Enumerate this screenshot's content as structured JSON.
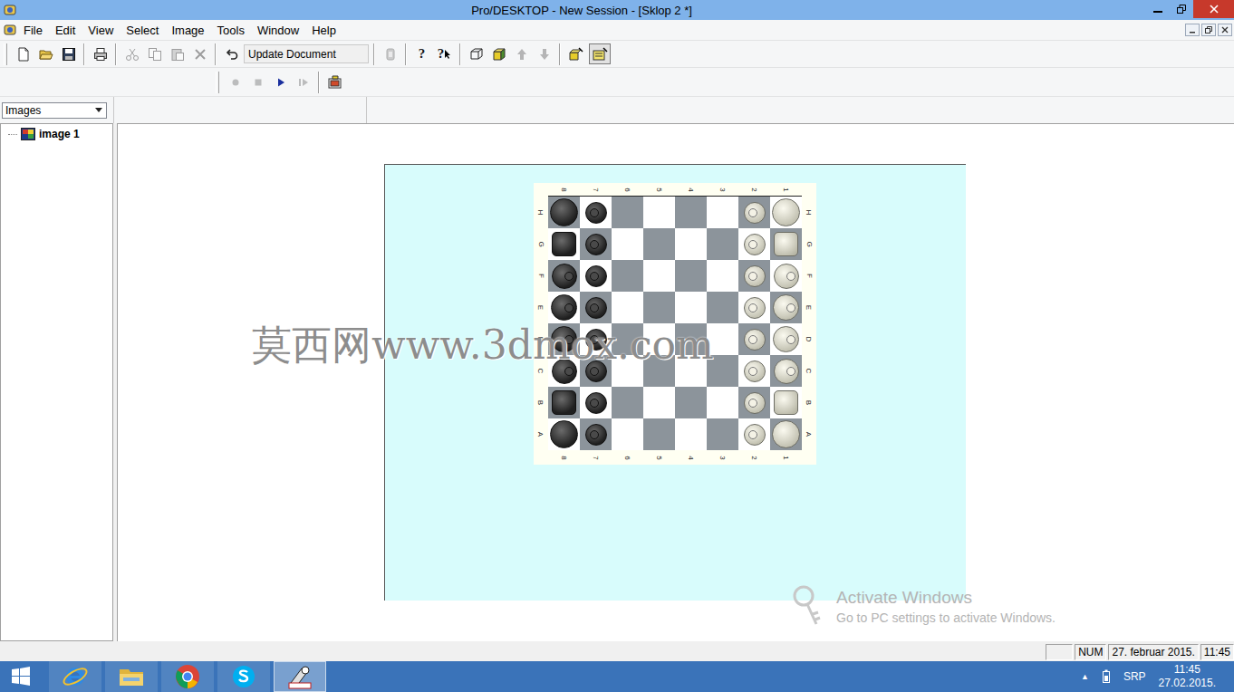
{
  "window": {
    "title": "Pro/DESKTOP - New Session - [Sklop 2 *]"
  },
  "menu": [
    "File",
    "Edit",
    "View",
    "Select",
    "Image",
    "Tools",
    "Window",
    "Help"
  ],
  "toolbar": [
    {
      "kind": "grip"
    },
    {
      "kind": "button",
      "disabled": false,
      "pressed": false
    },
    {
      "kind": "button",
      "disabled": false,
      "pressed": false
    },
    {
      "kind": "button",
      "disabled": false,
      "pressed": false
    },
    {
      "kind": "separator"
    },
    {
      "kind": "button",
      "disabled": false,
      "pressed": false
    },
    {
      "kind": "separator"
    },
    {
      "kind": "button",
      "disabled": true,
      "pressed": false
    },
    {
      "kind": "button",
      "disabled": true,
      "pressed": false
    },
    {
      "kind": "button",
      "disabled": true,
      "pressed": false
    },
    {
      "kind": "button",
      "disabled": true,
      "pressed": false
    },
    {
      "kind": "separator"
    },
    {
      "kind": "button",
      "disabled": false,
      "pressed": false
    },
    {
      "kind": "field",
      "text": "Update Document"
    },
    {
      "kind": "separator"
    },
    {
      "kind": "button",
      "disabled": true,
      "pressed": false
    },
    {
      "kind": "separator"
    },
    {
      "kind": "button",
      "disabled": false,
      "pressed": false,
      "glyph": "?"
    },
    {
      "kind": "button",
      "disabled": false,
      "pressed": false,
      "glyph": "?"
    },
    {
      "kind": "separator"
    },
    {
      "kind": "button",
      "disabled": false,
      "pressed": false
    },
    {
      "kind": "button",
      "disabled": false,
      "pressed": false
    },
    {
      "kind": "button",
      "disabled": true,
      "pressed": false
    },
    {
      "kind": "button",
      "disabled": true,
      "pressed": false
    },
    {
      "kind": "separator"
    },
    {
      "kind": "button",
      "disabled": false,
      "pressed": false
    },
    {
      "kind": "button",
      "disabled": false,
      "pressed": true
    }
  ],
  "toolbar2": [
    {
      "kind": "grip"
    },
    {
      "kind": "button",
      "disabled": true,
      "pressed": false
    },
    {
      "kind": "button",
      "disabled": true,
      "pressed": false
    },
    {
      "kind": "button",
      "disabled": false,
      "pressed": false
    },
    {
      "kind": "button",
      "disabled": true,
      "pressed": false
    },
    {
      "kind": "separator"
    },
    {
      "kind": "button",
      "disabled": false,
      "pressed": false
    }
  ],
  "view_select": {
    "value": "Images"
  },
  "tree": [
    {
      "label": "image 1",
      "selected": true
    }
  ],
  "board": {
    "ranks": [
      "8",
      "7",
      "6",
      "5",
      "4",
      "3",
      "2",
      "1"
    ],
    "files": [
      "H",
      "G",
      "F",
      "E",
      "D",
      "C",
      "B",
      "A"
    ],
    "rows": [
      [
        {
          "piece": "rook",
          "side": "black"
        },
        {
          "piece": "pawn",
          "side": "black"
        },
        {
          "piece": "empty",
          "side": "none"
        },
        {
          "piece": "empty",
          "side": "none"
        },
        {
          "piece": "empty",
          "side": "none"
        },
        {
          "piece": "empty",
          "side": "none"
        },
        {
          "piece": "pawn",
          "side": "white"
        },
        {
          "piece": "rook",
          "side": "white"
        }
      ],
      [
        {
          "piece": "knight",
          "side": "black"
        },
        {
          "piece": "pawn",
          "side": "black"
        },
        {
          "piece": "empty",
          "side": "none"
        },
        {
          "piece": "empty",
          "side": "none"
        },
        {
          "piece": "empty",
          "side": "none"
        },
        {
          "piece": "empty",
          "side": "none"
        },
        {
          "piece": "pawn",
          "side": "white"
        },
        {
          "piece": "knight",
          "side": "white"
        }
      ],
      [
        {
          "piece": "bishop",
          "side": "black"
        },
        {
          "piece": "pawn",
          "side": "black"
        },
        {
          "piece": "empty",
          "side": "none"
        },
        {
          "piece": "empty",
          "side": "none"
        },
        {
          "piece": "empty",
          "side": "none"
        },
        {
          "piece": "empty",
          "side": "none"
        },
        {
          "piece": "pawn",
          "side": "white"
        },
        {
          "piece": "bishop",
          "side": "white"
        }
      ],
      [
        {
          "piece": "king",
          "side": "black"
        },
        {
          "piece": "pawn",
          "side": "black"
        },
        {
          "piece": "empty",
          "side": "none"
        },
        {
          "piece": "empty",
          "side": "none"
        },
        {
          "piece": "empty",
          "side": "none"
        },
        {
          "piece": "empty",
          "side": "none"
        },
        {
          "piece": "pawn",
          "side": "white"
        },
        {
          "piece": "king",
          "side": "white"
        }
      ],
      [
        {
          "piece": "queen",
          "side": "black"
        },
        {
          "piece": "pawn",
          "side": "black"
        },
        {
          "piece": "empty",
          "side": "none"
        },
        {
          "piece": "empty",
          "side": "none"
        },
        {
          "piece": "empty",
          "side": "none"
        },
        {
          "piece": "empty",
          "side": "none"
        },
        {
          "piece": "pawn",
          "side": "white"
        },
        {
          "piece": "queen",
          "side": "white"
        }
      ],
      [
        {
          "piece": "bishop",
          "side": "black"
        },
        {
          "piece": "pawn",
          "side": "black"
        },
        {
          "piece": "empty",
          "side": "none"
        },
        {
          "piece": "empty",
          "side": "none"
        },
        {
          "piece": "empty",
          "side": "none"
        },
        {
          "piece": "empty",
          "side": "none"
        },
        {
          "piece": "pawn",
          "side": "white"
        },
        {
          "piece": "bishop",
          "side": "white"
        }
      ],
      [
        {
          "piece": "knight",
          "side": "black"
        },
        {
          "piece": "pawn",
          "side": "black"
        },
        {
          "piece": "empty",
          "side": "none"
        },
        {
          "piece": "empty",
          "side": "none"
        },
        {
          "piece": "empty",
          "side": "none"
        },
        {
          "piece": "empty",
          "side": "none"
        },
        {
          "piece": "pawn",
          "side": "white"
        },
        {
          "piece": "knight",
          "side": "white"
        }
      ],
      [
        {
          "piece": "rook",
          "side": "black"
        },
        {
          "piece": "pawn",
          "side": "black"
        },
        {
          "piece": "empty",
          "side": "none"
        },
        {
          "piece": "empty",
          "side": "none"
        },
        {
          "piece": "empty",
          "side": "none"
        },
        {
          "piece": "empty",
          "side": "none"
        },
        {
          "piece": "pawn",
          "side": "white"
        },
        {
          "piece": "rook",
          "side": "white"
        }
      ]
    ]
  },
  "watermark": "莫西网www.3dmox.com",
  "activation": {
    "title": "Activate Windows",
    "text": "Go to PC settings to activate Windows."
  },
  "status_bar": {
    "panes": [
      "",
      "NUM",
      "27. februar 2015.",
      "11:45"
    ]
  },
  "taskbar": {
    "apps": [
      {
        "active": false
      },
      {
        "active": false
      },
      {
        "active": false
      },
      {
        "active": false
      },
      {
        "active": true
      }
    ]
  },
  "tray": {
    "arrow": "▲",
    "language": "SRP",
    "time": "11:45",
    "date": "27.02.2015."
  }
}
